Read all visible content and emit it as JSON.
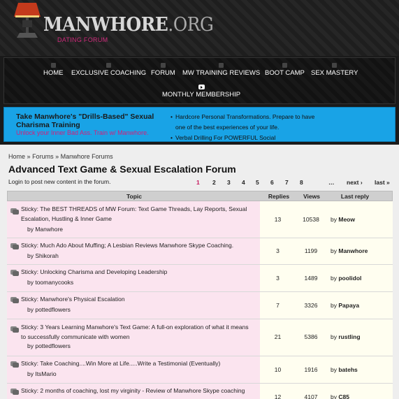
{
  "site": {
    "logo_main": "MANWHORE",
    "logo_tld": ".ORG",
    "logo_sub": "DATING FORUM"
  },
  "nav": {
    "items": [
      {
        "label": "HOME",
        "icon": "square-icon"
      },
      {
        "label": "EXCLUSIVE COACHING",
        "icon": "square-icon"
      },
      {
        "label": "FORUM",
        "icon": "square-icon"
      },
      {
        "label": "MW TRAINING REVIEWS",
        "icon": "square-icon"
      },
      {
        "label": "BOOT CAMP",
        "icon": "square-icon"
      },
      {
        "label": "SEX MASTERY",
        "icon": "square-icon"
      },
      {
        "label": "MONTHLY MEMBERSHIP",
        "icon": "youtube-icon"
      }
    ]
  },
  "promo": {
    "title": "Take Manwhore's \"Drills-Based\" Sexual Charisma Training",
    "subtitle": "Unlock your Inner Bad Ass. Train w/ Manwhore.",
    "bullets": [
      "Hardcore Personal Transformations. Prepare to have one of the best experiences of your life.",
      "Verbal Drilling For POWERFUL Social"
    ],
    "background": "#19a3e6",
    "subtitle_color": "#d61e7a"
  },
  "breadcrumb": {
    "home": "Home",
    "sep": "»",
    "forums": "Forums",
    "manwhore_forums": "Manwhore Forums"
  },
  "page_title": "Advanced Text Game & Sexual Escalation Forum",
  "login_note": "Login to post new content in the forum.",
  "pager": {
    "current": "1",
    "pages": [
      "2",
      "3",
      "4",
      "5",
      "6",
      "7",
      "8"
    ],
    "ellipsis": "…",
    "next": "next ›",
    "last": "last »",
    "accent": "#c7185e"
  },
  "table": {
    "headers": {
      "topic": "Topic",
      "replies": "Replies",
      "views": "Views",
      "last_reply": "Last reply"
    },
    "rows": [
      {
        "title": "Sticky: The BEST THREADS of MW Forum: Text Game Threads, Lay Reports, Sexual Escalation, Hustling & Inner Game",
        "author": "by Manwhore",
        "replies": "13",
        "views": "10538",
        "last_by": "by",
        "last_user": "Meow"
      },
      {
        "title": "Sticky: Much Ado About Muffing; A Lesbian Reviews Manwhore Skype Coaching.",
        "author": "by Shikorah",
        "replies": "3",
        "views": "1199",
        "last_by": "by",
        "last_user": "Manwhore"
      },
      {
        "title": "Sticky: Unlocking Charisma and Developing Leadership",
        "author": "by toomanycooks",
        "replies": "3",
        "views": "1489",
        "last_by": "by",
        "last_user": "poolidol"
      },
      {
        "title": "Sticky: Manwhore's Physical Escalation",
        "author": "by pottedflowers",
        "replies": "7",
        "views": "3326",
        "last_by": "by",
        "last_user": "Papaya"
      },
      {
        "title": "Sticky: 3 Years Learning Manwhore's Text Game: A full-on exploration of what it means to successfully communicate with women",
        "author": "by pottedflowers",
        "replies": "21",
        "views": "5386",
        "last_by": "by",
        "last_user": "rustling"
      },
      {
        "title": "Sticky: Take Coaching....Win More at Life.....Write a Testimonial (Eventually)",
        "author": "by ItsMario",
        "replies": "10",
        "views": "1916",
        "last_by": "by",
        "last_user": "batehs"
      },
      {
        "title": "Sticky: 2 months of coaching, lost my virginity - Review of Manwhore Skype coaching",
        "author": "",
        "replies": "12",
        "views": "4107",
        "last_by": "by",
        "last_user": "C85"
      }
    ]
  }
}
